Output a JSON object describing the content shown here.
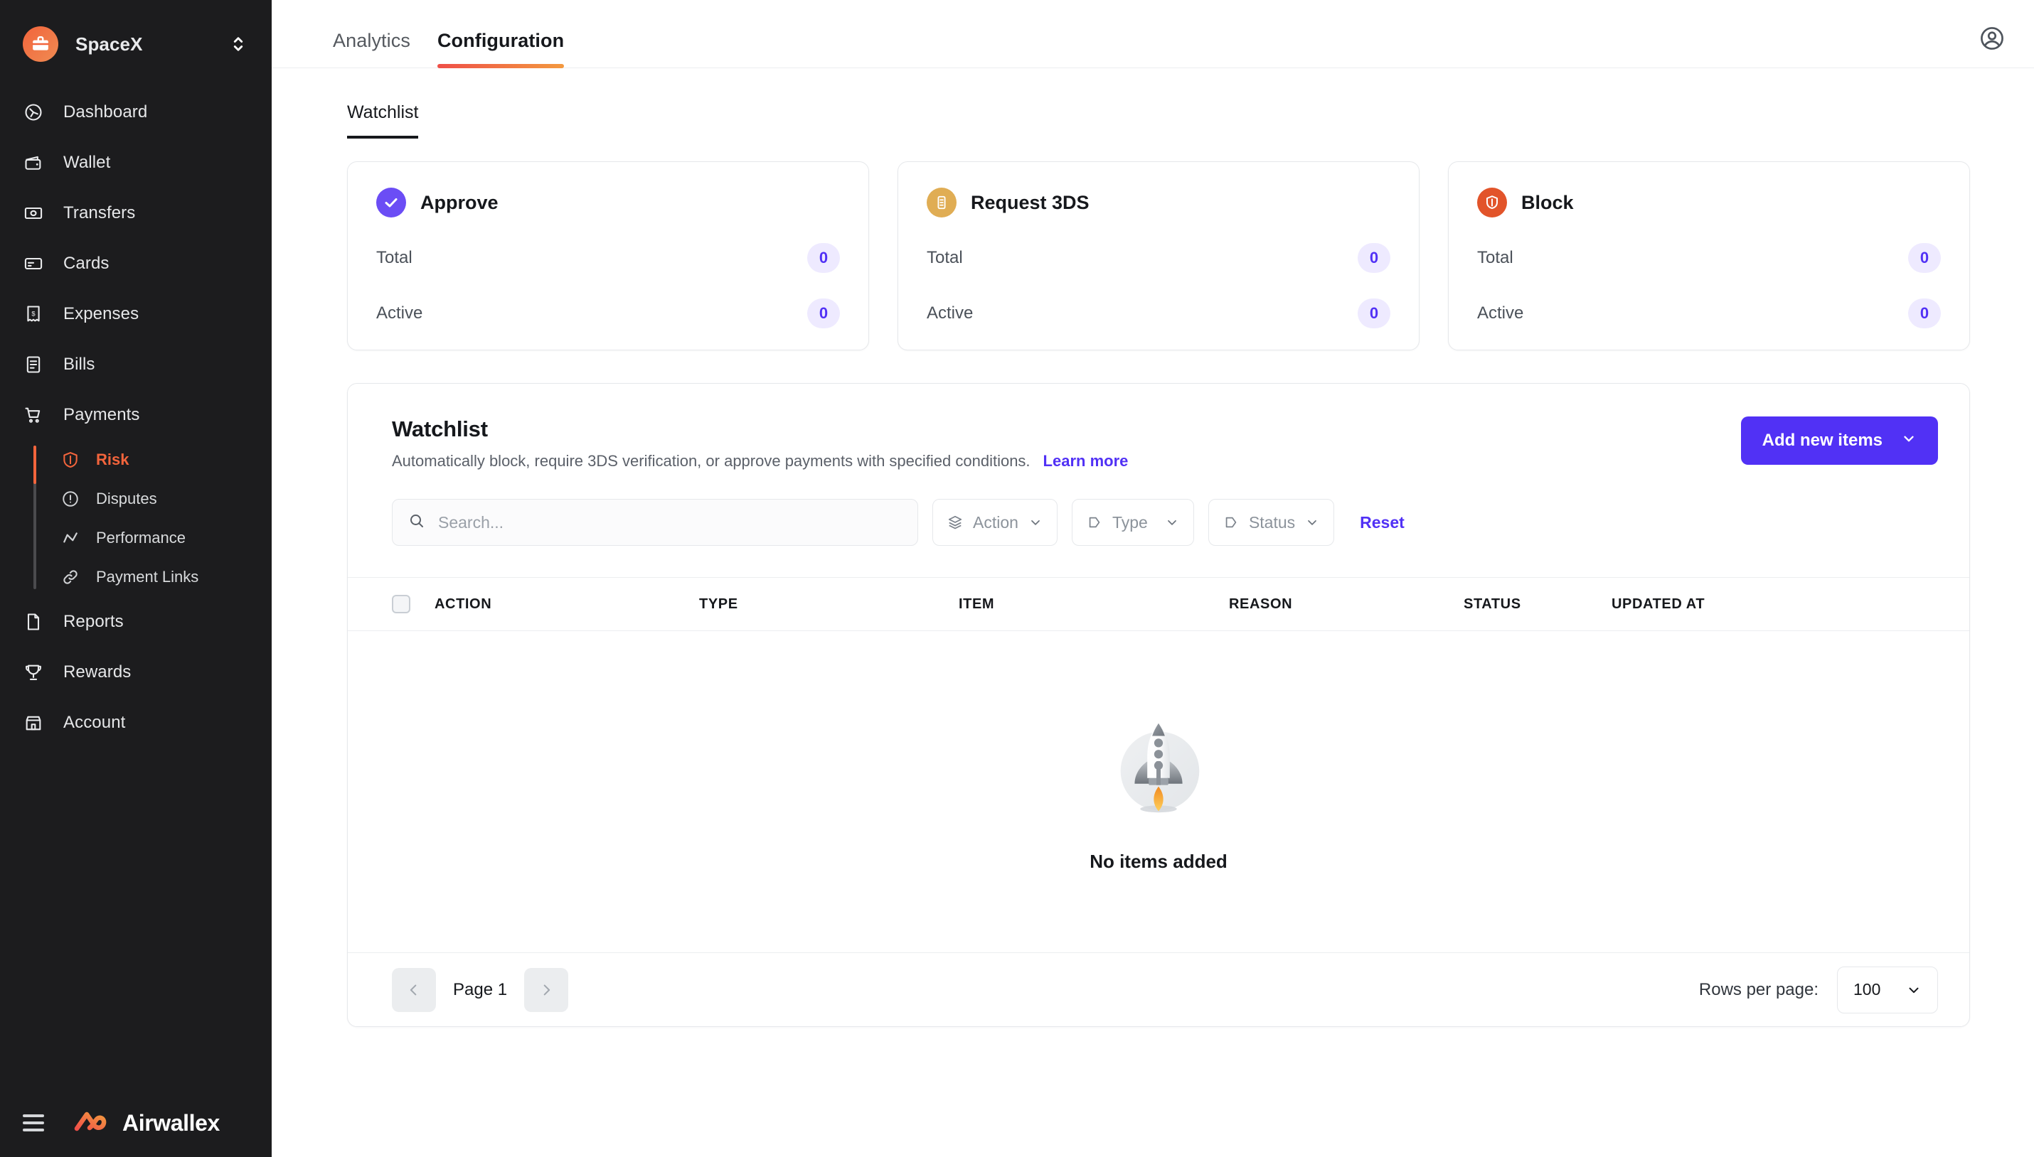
{
  "sidebar": {
    "org": {
      "name": "SpaceX",
      "icon": "briefcase-icon",
      "switcher_icon": "chevron-updown-icon",
      "badge_color": "#f2643c"
    },
    "items": [
      {
        "label": "Dashboard",
        "icon": "dashboard-icon"
      },
      {
        "label": "Wallet",
        "icon": "wallet-icon"
      },
      {
        "label": "Transfers",
        "icon": "transfers-icon"
      },
      {
        "label": "Cards",
        "icon": "cards-icon"
      },
      {
        "label": "Expenses",
        "icon": "expenses-icon"
      },
      {
        "label": "Bills",
        "icon": "bills-icon"
      },
      {
        "label": "Payments",
        "icon": "payments-icon"
      }
    ],
    "subitems": [
      {
        "label": "Risk",
        "icon": "shield-icon",
        "active": true
      },
      {
        "label": "Disputes",
        "icon": "alert-circle-icon",
        "active": false
      },
      {
        "label": "Performance",
        "icon": "performance-icon",
        "active": false
      },
      {
        "label": "Payment Links",
        "icon": "link-icon",
        "active": false
      }
    ],
    "items_after": [
      {
        "label": "Reports",
        "icon": "reports-icon"
      },
      {
        "label": "Rewards",
        "icon": "trophy-icon"
      },
      {
        "label": "Account",
        "icon": "account-icon"
      }
    ],
    "footer": {
      "menu_icon": "hamburger-icon",
      "brand": "Airwallex",
      "brand_mark_icon": "airwallex-logo-icon"
    },
    "active_color": "#f2643c"
  },
  "topbar": {
    "tabs": [
      {
        "label": "Analytics",
        "active": false
      },
      {
        "label": "Configuration",
        "active": true
      }
    ],
    "avatar_icon": "user-circle-icon"
  },
  "subtabs": [
    {
      "label": "Watchlist",
      "active": true
    }
  ],
  "stat_cards": [
    {
      "title": "Approve",
      "icon": "check-circle-icon",
      "icon_color": "#6b4df5",
      "rows": [
        {
          "label": "Total",
          "value": "0"
        },
        {
          "label": "Active",
          "value": "0"
        }
      ]
    },
    {
      "title": "Request 3DS",
      "icon": "request-3ds-icon",
      "icon_color": "#e0ad54",
      "rows": [
        {
          "label": "Total",
          "value": "0"
        },
        {
          "label": "Active",
          "value": "0"
        }
      ]
    },
    {
      "title": "Block",
      "icon": "block-shield-icon",
      "icon_color": "#e2542a",
      "rows": [
        {
          "label": "Total",
          "value": "0"
        },
        {
          "label": "Active",
          "value": "0"
        }
      ]
    }
  ],
  "panel": {
    "title": "Watchlist",
    "description": "Automatically block, require 3DS verification, or approve payments with specified conditions.",
    "learn_more": "Learn more",
    "add_button": "Add new items",
    "add_button_icon": "chevron-down-icon",
    "accent_color": "#5131f5"
  },
  "filters": {
    "search_placeholder": "Search...",
    "search_value": "",
    "search_icon": "search-icon",
    "chips": [
      {
        "label": "Action",
        "icon": "layers-icon"
      },
      {
        "label": "Type",
        "icon": "tag-icon"
      },
      {
        "label": "Status",
        "icon": "tag-icon"
      }
    ],
    "reset": "Reset"
  },
  "table": {
    "select_all_checkbox": false,
    "columns": [
      "ACTION",
      "TYPE",
      "ITEM",
      "REASON",
      "STATUS",
      "UPDATED AT"
    ],
    "rows": [],
    "empty_state": {
      "text": "No items added",
      "illustration": "rocket-illustration"
    }
  },
  "pagination": {
    "prev_icon": "chevron-left-icon",
    "next_icon": "chevron-right-icon",
    "page_label": "Page 1",
    "rows_per_page_label": "Rows per page:",
    "rows_per_page_value": "100",
    "rows_per_page_icon": "chevron-down-icon"
  }
}
